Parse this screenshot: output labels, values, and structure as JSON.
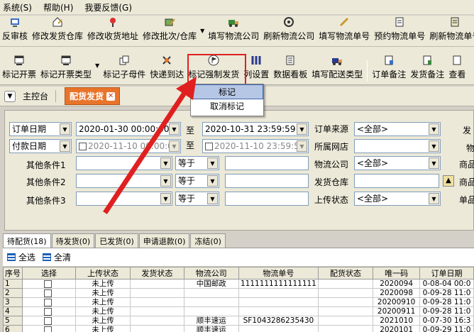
{
  "menubar": [
    "系统(S)",
    "帮助(H)",
    "我要反馈(G)"
  ],
  "toolbar1": [
    "反审核",
    "修改发货仓库",
    "修改收货地址",
    "修改批次/仓库",
    "填写物流公司",
    "刷新物流公司",
    "填写物流单号",
    "预约物流单号",
    "刷新物流单号"
  ],
  "toolbar2": [
    "标记开票",
    "标记开票类型",
    "标记子母件",
    "快递到达",
    "标记强制发货",
    "列设置",
    "数据看板",
    "填写配送类型",
    "订单备注",
    "发货备注",
    "查看"
  ],
  "popup": {
    "mark": "标记",
    "unmark": "取消标记"
  },
  "tabs": {
    "home": "主控台",
    "active": "配货发货"
  },
  "filters": {
    "date_type": "订单日期",
    "date_from": "2020-01-30 00:00:00",
    "to1": "至",
    "date_to": "2020-10-31 23:59:59",
    "order_source_label": "订单来源",
    "order_source": "<全部>",
    "pay_type": "付款日期",
    "pay_from": "2020-11-10 00:00:00",
    "to2": "至",
    "pay_to": "2020-11-10 23:59:59",
    "shop_label": "所属网店",
    "shop": "",
    "cond1": "其他条件1",
    "cond2": "其他条件2",
    "cond3": "其他条件3",
    "eq": "等于",
    "logistics_label": "物流公司",
    "logistics": "<全部>",
    "warehouse_label": "发货仓库",
    "warehouse": "",
    "upload_label": "上传状态",
    "upload": "<全部>",
    "right1": "发",
    "right2": "物",
    "right3": "商品",
    "right4": "商品",
    "right5": "单品"
  },
  "lower_tabs": [
    "待配货(18)",
    "待发货(0)",
    "已发货(0)",
    "申请退款(0)",
    "冻结(0)"
  ],
  "actions": {
    "select_all": "全选",
    "clear": "全清"
  },
  "grid": {
    "headers": [
      "序号",
      "选择",
      "上传状态",
      "发货状态",
      "物流公司",
      "物流单号",
      "配货状态",
      "唯一码",
      "订单日期"
    ],
    "rows": [
      [
        "1",
        "",
        "未上传",
        "",
        "中国邮政",
        "1111111111111111",
        "",
        "2020094",
        "0-08-04 00:0"
      ],
      [
        "2",
        "",
        "未上传",
        "",
        "",
        "",
        "",
        "2020098",
        "0-09-28 11:0"
      ],
      [
        "3",
        "",
        "未上传",
        "",
        "",
        "",
        "",
        "20200910",
        "0-09-28 11:0"
      ],
      [
        "4",
        "",
        "未上传",
        "",
        "",
        "",
        "",
        "20200911",
        "0-09-28 11:0"
      ],
      [
        "5",
        "",
        "未上传",
        "",
        "顺丰速运",
        "SF1043286235430",
        "",
        "2021010",
        "0-07-30 16:3"
      ],
      [
        "6",
        "",
        "未上传",
        "",
        "顺丰速运",
        "",
        "",
        "2020101",
        "0-09-29 11:0"
      ]
    ]
  }
}
